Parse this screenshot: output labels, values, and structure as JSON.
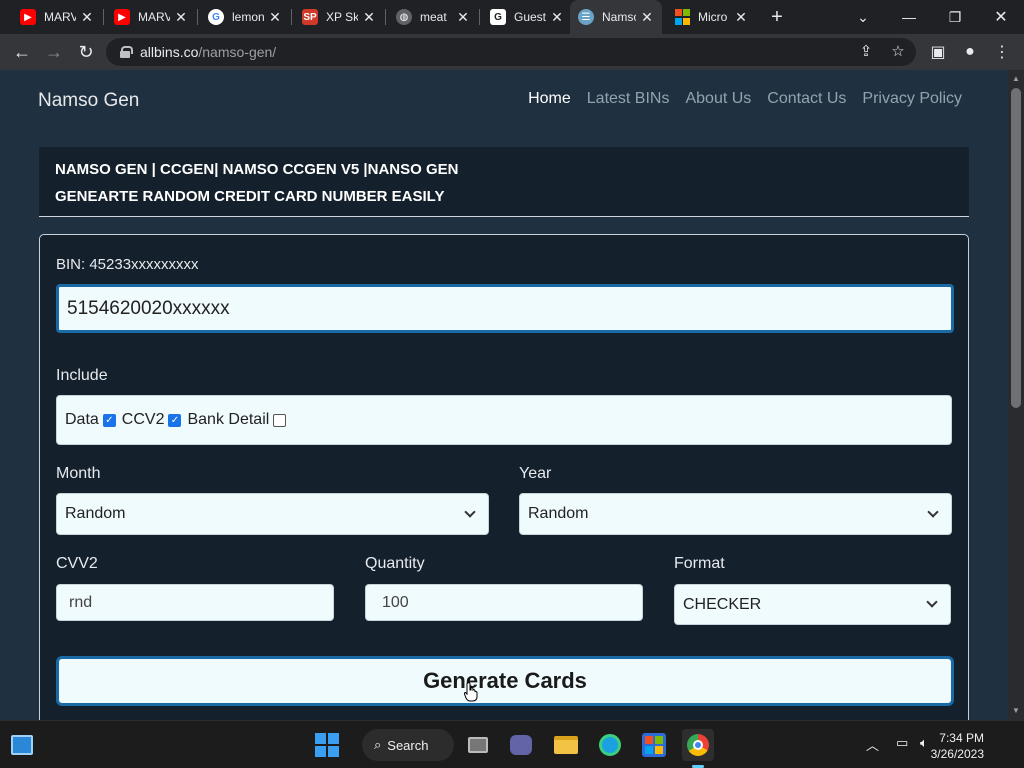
{
  "browser": {
    "tabs": [
      {
        "title": "MARVEL",
        "favicon": "youtube-icon",
        "color": "#ff0000",
        "active": false
      },
      {
        "title": "MARVEL",
        "favicon": "youtube-icon",
        "color": "#ff0000",
        "active": false
      },
      {
        "title": "lemon",
        "favicon": "google-icon",
        "color": "#4285f4",
        "active": false
      },
      {
        "title": "XP Sk",
        "favicon": "xp-icon",
        "color": "#d1392b",
        "active": false
      },
      {
        "title": "meat",
        "favicon": "globe-icon",
        "color": "#9aa0a6",
        "active": false
      },
      {
        "title": "Guest",
        "favicon": "g-icon",
        "color": "#ffffff",
        "active": false
      },
      {
        "title": "Namso",
        "favicon": "namso-icon",
        "color": "#6ba3c7",
        "active": true
      },
      {
        "title": "Micro",
        "favicon": "microsoft-icon",
        "color": "#f25022",
        "active": false
      }
    ],
    "close_glyph": "✕",
    "new_tab_glyph": "+",
    "url_domain": "allbins.co",
    "url_path": "/namso-gen/",
    "accent": "#1a73e8"
  },
  "site": {
    "brand": "Namso Gen",
    "nav": [
      "Home",
      "Latest BINs",
      "About Us",
      "Contact Us",
      "Privacy Policy"
    ],
    "active_nav": "Home",
    "heading_line1": "NAMSO GEN | CCGEN| NAMSO CCGEN V5 |NANSO GEN",
    "heading_line2": "GENEARTE RANDOM CREDIT CARD NUMBER EASILY"
  },
  "form": {
    "bin_label": "BIN: 45233xxxxxxxxx",
    "bin_value": "5154620020xxxxxx",
    "include_label": "Include",
    "include_options": [
      {
        "label": "Data",
        "checked": true
      },
      {
        "label": "CCV2",
        "checked": true
      },
      {
        "label": "Bank Detail",
        "checked": false
      }
    ],
    "month_label": "Month",
    "month_value": "Random",
    "year_label": "Year",
    "year_value": "Random",
    "cvv_label": "CVV2",
    "cvv_value": "rnd",
    "quantity_label": "Quantity",
    "quantity_value": "100",
    "format_label": "Format",
    "format_value": "CHECKER",
    "generate_label": "Generate Cards",
    "focus_color": "#1a6aa6"
  },
  "taskbar": {
    "search_label": "Search",
    "time": "7:34 PM",
    "date": "3/26/2023"
  }
}
